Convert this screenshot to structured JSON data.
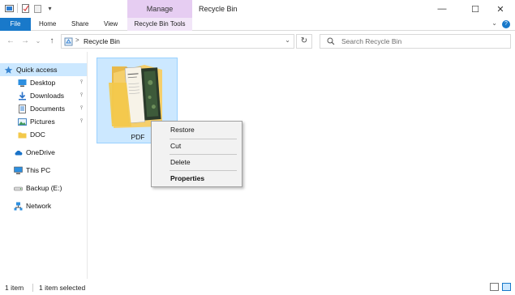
{
  "window": {
    "title": "Recycle Bin",
    "context_tab_header": "Manage",
    "minimize_glyph": "—",
    "maximize_glyph": "☐",
    "close_glyph": "✕"
  },
  "quick_access_toolbar": {
    "dropdown_glyph": "▾"
  },
  "ribbon": {
    "tabs": [
      "File",
      "Home",
      "Share",
      "View",
      "Recycle Bin Tools"
    ],
    "expand_glyph": "⌄",
    "help_glyph": "?"
  },
  "navigation": {
    "back_glyph": "←",
    "forward_glyph": "→",
    "recent_glyph": "⌄",
    "up_glyph": "↑",
    "breadcrumb_chevron": ">",
    "breadcrumb": "Recycle Bin",
    "address_dropdown_glyph": "⌄",
    "refresh_glyph": "↻",
    "search_placeholder": "Search Recycle Bin"
  },
  "nav_pane": {
    "items": [
      {
        "label": "Quick access",
        "icon": "star-icon",
        "selected": true,
        "pinned": false
      },
      {
        "label": "Desktop",
        "icon": "desktop-icon",
        "selected": false,
        "pinned": true
      },
      {
        "label": "Downloads",
        "icon": "download-icon",
        "selected": false,
        "pinned": true
      },
      {
        "label": "Documents",
        "icon": "documents-icon",
        "selected": false,
        "pinned": true
      },
      {
        "label": "Pictures",
        "icon": "pictures-icon",
        "selected": false,
        "pinned": true
      },
      {
        "label": "DOC",
        "icon": "folder-icon",
        "selected": false,
        "pinned": false
      },
      {
        "label": "OneDrive",
        "icon": "cloud-icon",
        "selected": false,
        "pinned": false
      },
      {
        "label": "This PC",
        "icon": "computer-icon",
        "selected": false,
        "pinned": false
      },
      {
        "label": "Backup (E:)",
        "icon": "drive-icon",
        "selected": false,
        "pinned": false
      },
      {
        "label": "Network",
        "icon": "network-icon",
        "selected": false,
        "pinned": false
      }
    ],
    "pin_glyph": "📌"
  },
  "content": {
    "items": [
      {
        "name": "PDF",
        "type": "folder",
        "selected": true
      }
    ]
  },
  "context_menu": {
    "items": [
      "Restore",
      "Cut",
      "Delete",
      "Properties"
    ],
    "default_item": "Properties"
  },
  "status_bar": {
    "item_count": "1 item",
    "selection": "1 item selected"
  },
  "colors": {
    "accent": "#1979ca",
    "selection": "#cce8ff",
    "manage_tab": "#e6cdf2"
  }
}
